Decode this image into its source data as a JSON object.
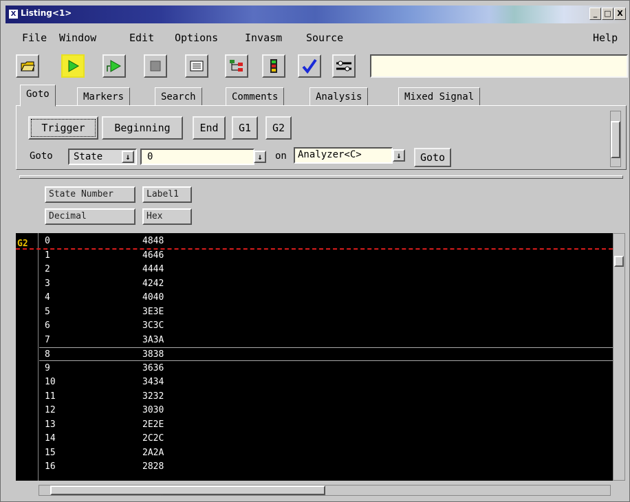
{
  "window": {
    "title": "Listing<1>",
    "controls": [
      "_",
      "□",
      "X"
    ]
  },
  "menu": [
    "File",
    "Window",
    "Edit",
    "Options",
    "Invasm",
    "Source"
  ],
  "help": "Help",
  "tabs": [
    "Goto",
    "Markers",
    "Search",
    "Comments",
    "Analysis",
    "Mixed Signal"
  ],
  "goto": {
    "buttons": [
      "Trigger",
      "Beginning",
      "End",
      "G1",
      "G2"
    ],
    "label": "Goto",
    "mode": "State",
    "value": "0",
    "on_label": "on",
    "analyzer": "Analyzer<C>",
    "go_button": "Goto"
  },
  "columns": [
    {
      "name": "State Number",
      "base": "Decimal"
    },
    {
      "name": "Label1",
      "base": "Hex"
    }
  ],
  "marker": "G2",
  "rows": [
    [
      "0",
      "4848"
    ],
    [
      "1",
      "4646"
    ],
    [
      "2",
      "4444"
    ],
    [
      "3",
      "4242"
    ],
    [
      "4",
      "4040"
    ],
    [
      "5",
      "3E3E"
    ],
    [
      "6",
      "3C3C"
    ],
    [
      "7",
      "3A3A"
    ],
    [
      "8",
      "3838"
    ],
    [
      "9",
      "3636"
    ],
    [
      "10",
      "3434"
    ],
    [
      "11",
      "3232"
    ],
    [
      "12",
      "3030"
    ],
    [
      "13",
      "2E2E"
    ],
    [
      "14",
      "2C2C"
    ],
    [
      "15",
      "2A2A"
    ],
    [
      "16",
      "2828"
    ]
  ],
  "selected_row": 8,
  "colors": {
    "trigger_play": "#2ec82e",
    "marker_red": "#d81c1c",
    "marker_green": "#1faa1f",
    "g2_label": "#e8c000",
    "check": "#1a2ad8"
  }
}
